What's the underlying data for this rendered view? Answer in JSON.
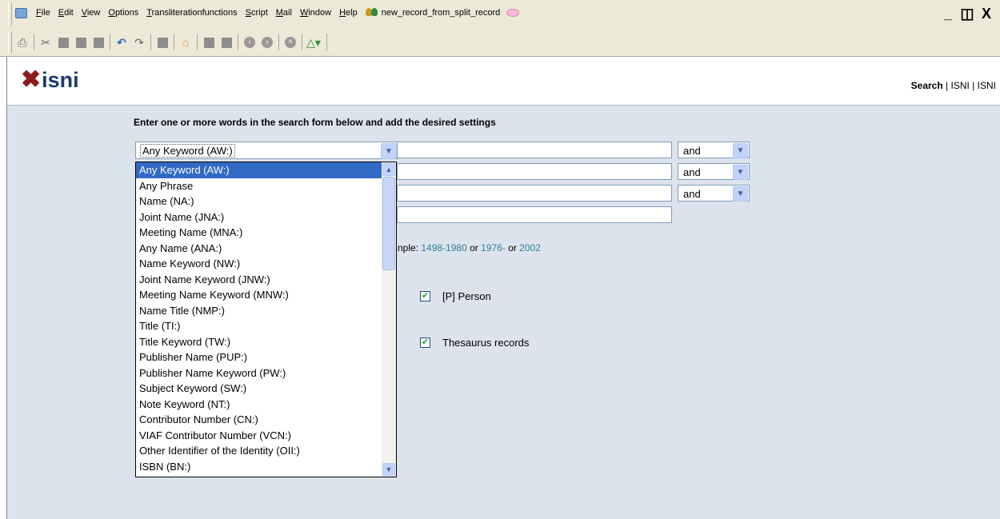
{
  "menubar": {
    "items": [
      "File",
      "Edit",
      "View",
      "Options",
      "Transliterationfunctions",
      "Script",
      "Mail",
      "Window",
      "Help"
    ],
    "document_title": "new_record_from_split_record",
    "window_controls": [
      "_",
      "❐",
      "X"
    ]
  },
  "toolbar": {
    "icons": [
      "print-icon",
      "cut-icon",
      "copy-icon",
      "paste-icon",
      "delete-icon",
      "undo-icon",
      "redo-icon",
      "save-icon",
      "home-icon",
      "record-icon",
      "record2-icon",
      "back-icon",
      "forward-icon",
      "up-icon",
      "tool-icon"
    ]
  },
  "header": {
    "logo_text": "isni",
    "nav": {
      "search": "Search",
      "sep": "|",
      "isni1": "ISNI",
      "isni2": "ISNI"
    }
  },
  "form": {
    "instruction": "Enter one or more words in the search form below and add the desired settings",
    "field_select_value": "Any Keyword (AW:)",
    "operators": [
      "and",
      "and",
      "and"
    ],
    "year_hint_prefix": "nple: ",
    "year_examples": [
      "1498-1980",
      "or",
      "1976-",
      "or",
      "2002"
    ],
    "checkbox_person": "[P] Person",
    "checkbox_thesaurus": "Thesaurus records"
  },
  "dropdown": {
    "options": [
      "Any Keyword (AW:)",
      "Any Phrase",
      "Name (NA:)",
      "Joint Name (JNA:)",
      "Meeting Name (MNA:)",
      "Any Name (ANA:)",
      "Name Keyword (NW:)",
      "Joint Name Keyword (JNW:)",
      "Meeting Name Keyword (MNW:)",
      "Name Title (NMP:)",
      "Title (TI:)",
      "Title Keyword (TW:)",
      "Publisher Name (PUP:)",
      "Publisher Name Keyword (PW:)",
      "Subject Keyword (SW:)",
      "Note Keyword (NT:)",
      "Contributor Number (CN:)",
      "VIAF Contributor Number (VCN:)",
      "Other Identifier of the Identity (OII:)",
      "ISBN (BN:)"
    ],
    "selected_index": 0
  }
}
